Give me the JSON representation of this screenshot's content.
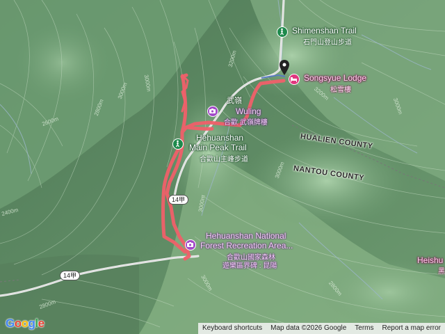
{
  "map": {
    "trails": {
      "shimenshan": {
        "name": "Shimenshan Trail",
        "name_zh": "石門山登山步道",
        "icon": "hiking-icon"
      },
      "hehuanshan_main": {
        "name_line1": "Hehuanshan",
        "name_line2": "Main Peak Trail",
        "name_zh": "合歡山主峰步道",
        "icon": "hiking-icon"
      }
    },
    "lodging": {
      "name": "Songsyue Lodge",
      "name_zh": "松雪樓",
      "icon": "hotel-icon"
    },
    "attractions": {
      "wuling": {
        "name": "Wuling",
        "name_zh_top": "武嶺",
        "name_zh": "合歡  武嶺牌樓",
        "icon": "camera-icon"
      },
      "forest_recreation": {
        "name_line1": "Hehuanshan National",
        "name_line2": "Forest Recreation Area...",
        "name_zh_1": "合歡山國家森林",
        "name_zh_2": "遊樂區界碑 : 昆陽",
        "icon": "camera-icon"
      }
    },
    "partial_place": {
      "name": "Heishu",
      "name_zh": "黑"
    },
    "counties": {
      "hualien": "HUALIEN COUNTY",
      "nantou": "NANTOU COUNTY"
    },
    "roads": {
      "route_14a": "14甲",
      "route_14a_b": "14甲"
    },
    "contours": [
      "3200m",
      "3000m",
      "2800m",
      "2600m",
      "2400m",
      "3000m",
      "3000m",
      "3000m",
      "3000m",
      "3000m",
      "3200m",
      "2800m",
      "2800m"
    ],
    "route_color": "#f0606a",
    "marker_color": "#222222"
  },
  "footer": {
    "logo": "Google",
    "shortcuts": "Keyboard shortcuts",
    "map_data": "Map data ©2026 Google",
    "terms": "Terms",
    "report": "Report a map error"
  }
}
